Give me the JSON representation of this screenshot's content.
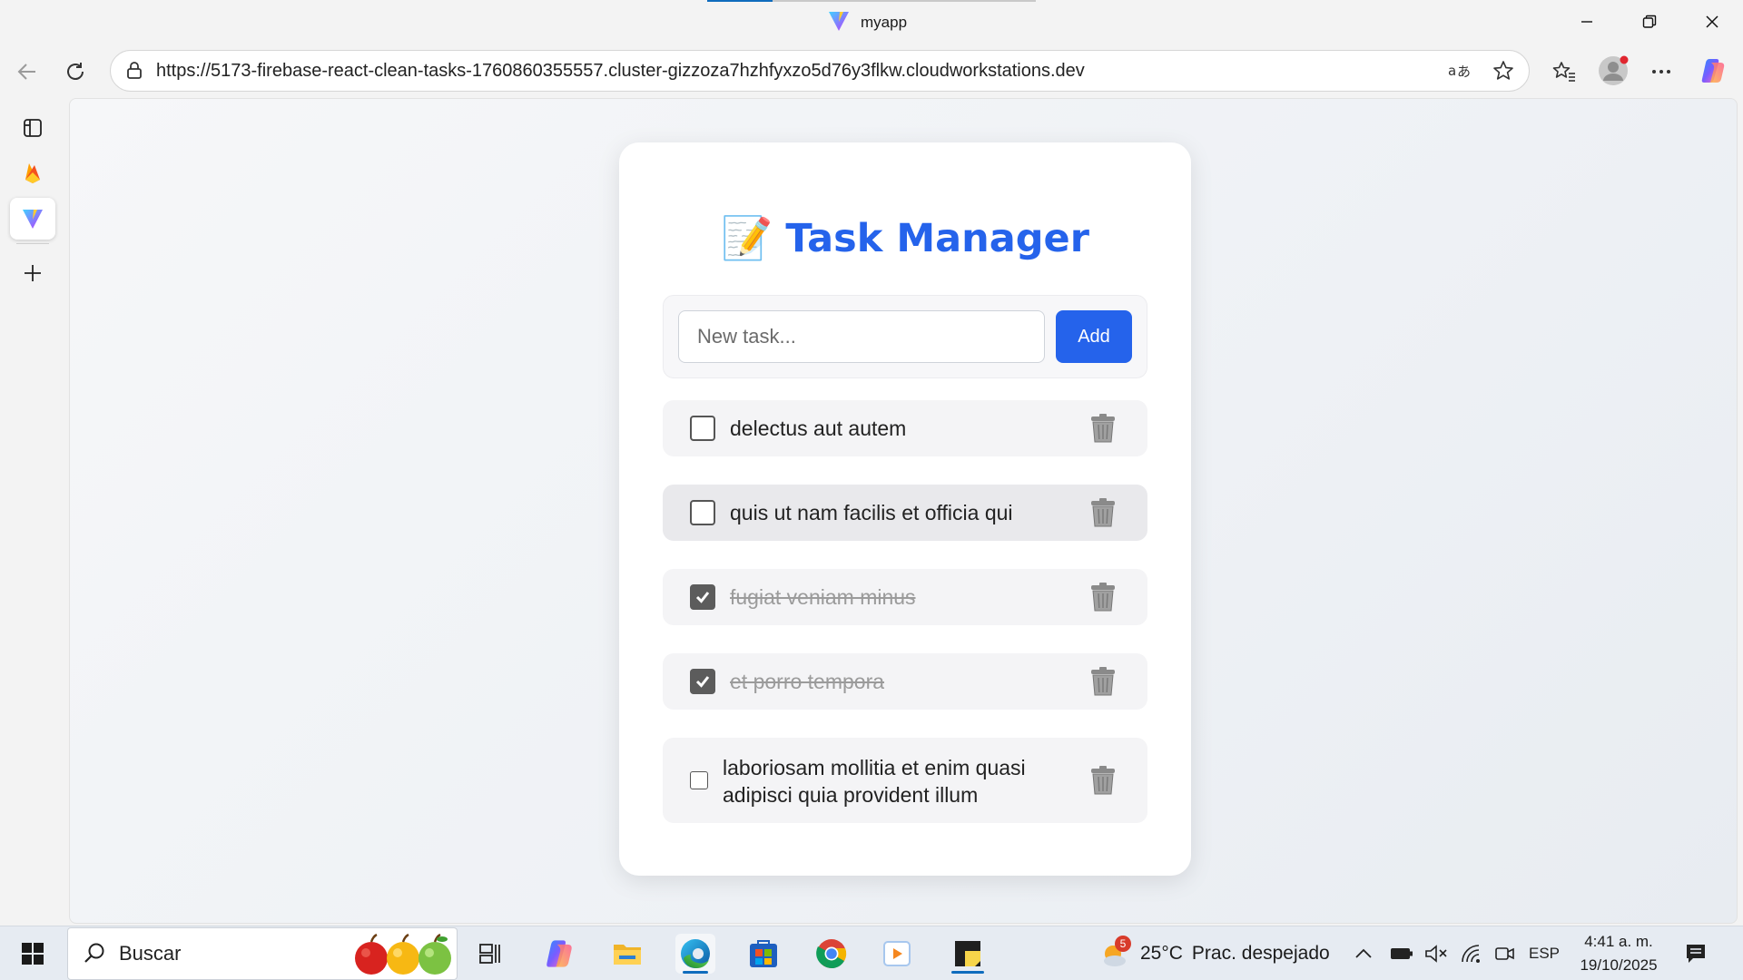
{
  "browser": {
    "tab_title": "myapp",
    "url": "https://5173-firebase-react-clean-tasks-1760860355557.cluster-gizzoza7hzhfyxzo5d76y3flkw.cloudworkstations.dev"
  },
  "app": {
    "title": "Task Manager",
    "title_emoji": "📝",
    "input_placeholder": "New task...",
    "add_label": "Add",
    "accent_color": "#2563eb",
    "tasks": [
      {
        "text": "delectus aut autem",
        "completed": false
      },
      {
        "text": "quis ut nam facilis et officia qui",
        "completed": false
      },
      {
        "text": "fugiat veniam minus",
        "completed": true
      },
      {
        "text": "et porro tempora",
        "completed": true
      },
      {
        "text": "laboriosam mollitia et enim quasi adipisci quia provident illum",
        "completed": false
      }
    ]
  },
  "taskbar": {
    "search_label": "Buscar",
    "weather": {
      "temp": "25°C",
      "condition": "Prac. despejado",
      "badge": "5"
    },
    "language": "ESP",
    "time": "4:41 a. m.",
    "date": "19/10/2025"
  }
}
